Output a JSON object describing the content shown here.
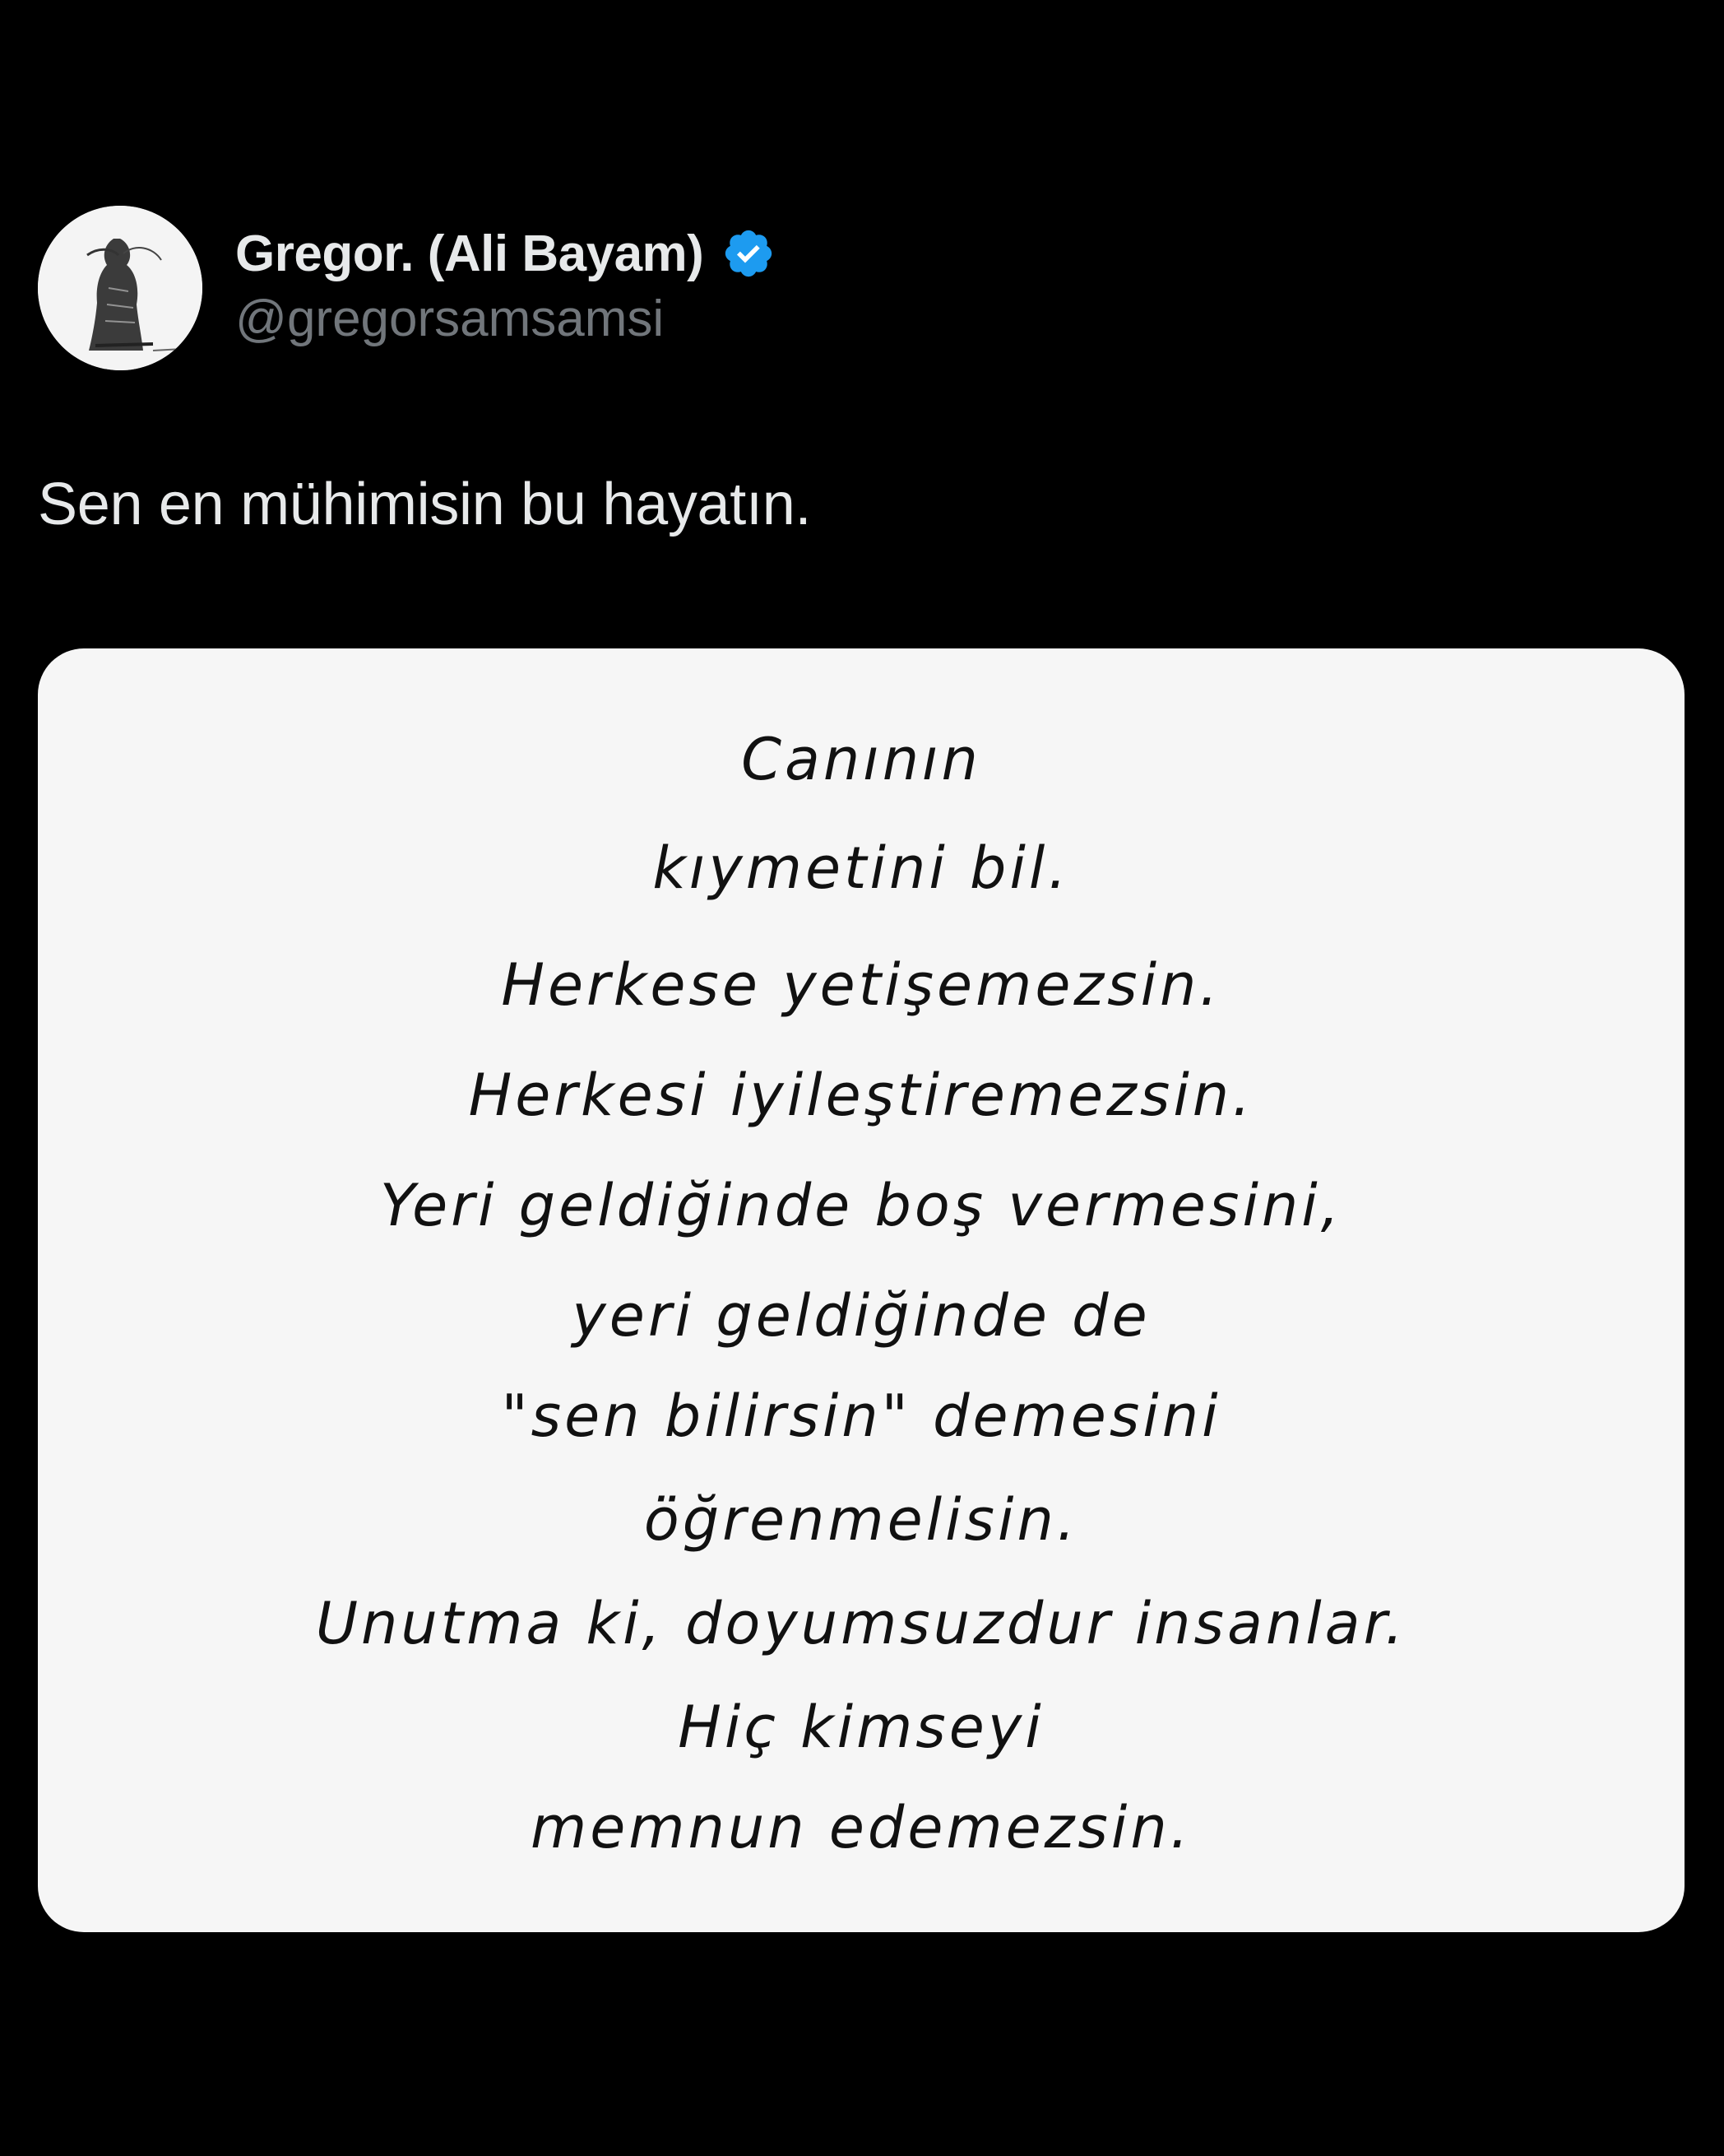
{
  "author": {
    "display_name": "Gregor. (Ali Bayam)",
    "handle": "@gregorsamsamsi",
    "verified": true,
    "verified_badge_color": "#1d9bf0",
    "avatar_icon": "sketch-portrait-avatar"
  },
  "tweet": {
    "text": "Sen en mühimisin bu hayatın."
  },
  "media": {
    "background_color": "#f6f6f6",
    "lines": [
      "Canının",
      "kıymetini bil.",
      "Herkese yetişemezsin.",
      "Herkesi iyileştiremezsin.",
      "Yeri geldiğinde boş vermesini,",
      "yeri geldiğinde de",
      "\"sen bilirsin\" demesini",
      "öğrenmelisin.",
      "Unutma ki, doyumsuzdur insanlar.",
      "Hiç kimseyi",
      "memnun edemezsin."
    ]
  },
  "colors": {
    "background": "#000000",
    "primary_text": "#e7e9ea",
    "secondary_text": "#71767b"
  }
}
